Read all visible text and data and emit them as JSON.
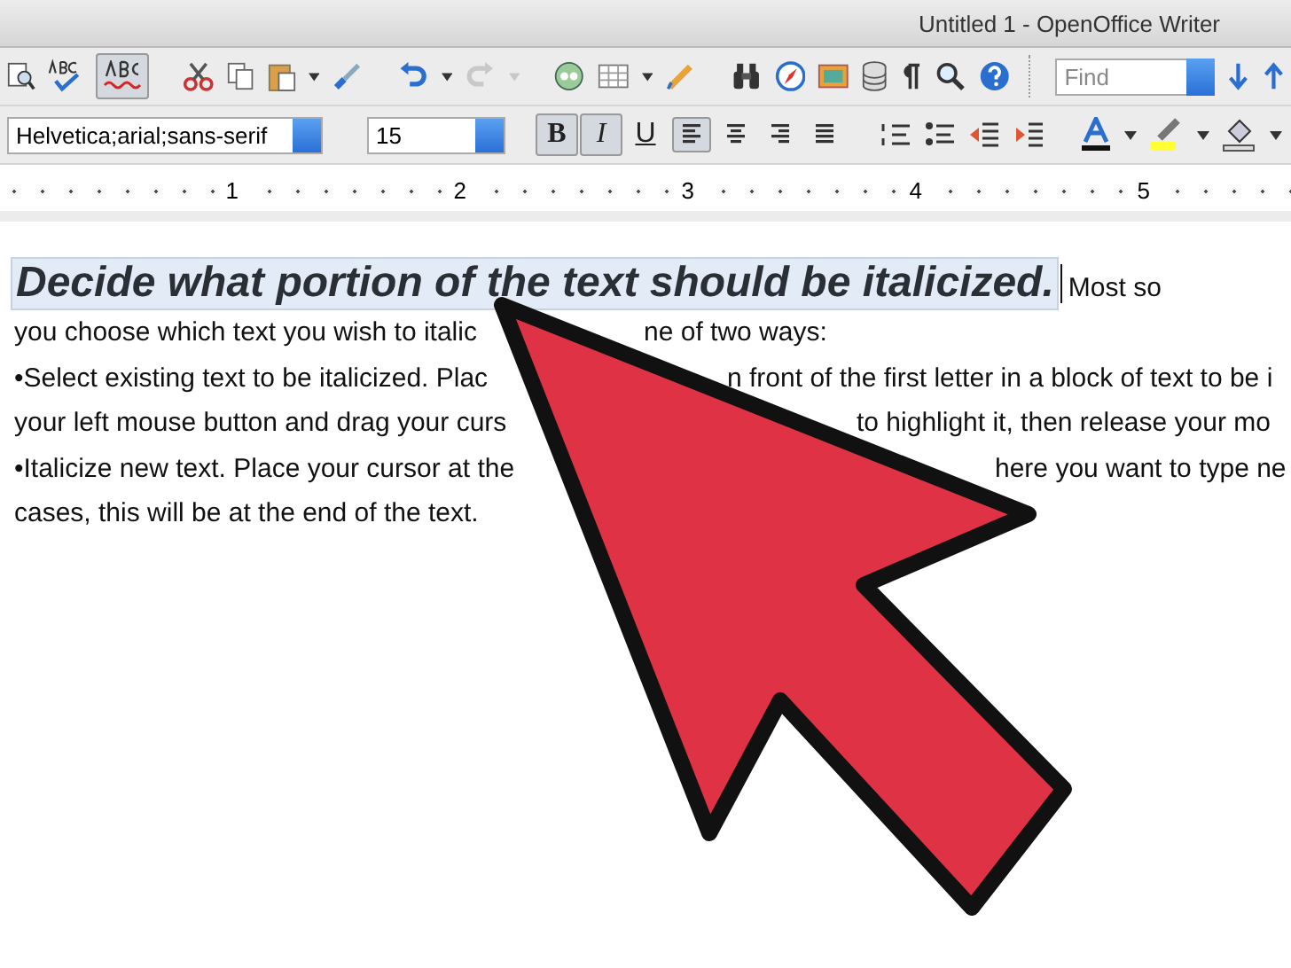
{
  "window": {
    "title": "Untitled 1 - OpenOffice Writer"
  },
  "standard_toolbar": {
    "autospell_selected": true,
    "redo_disabled": true,
    "find_field": {
      "placeholder": "Find"
    }
  },
  "formatting_toolbar": {
    "font_name": "Helvetica;arial;sans-serif",
    "font_size": "15",
    "bold": {
      "label": "B",
      "selected": true
    },
    "italic": {
      "label": "I",
      "selected": true
    },
    "underline": {
      "label": "U",
      "selected": false
    },
    "alignments": [
      {
        "selected": true
      },
      {
        "selected": false
      },
      {
        "selected": false
      },
      {
        "selected": false
      }
    ]
  },
  "ruler": {
    "numbers": [
      "1",
      "2",
      "3",
      "4",
      "5"
    ]
  },
  "document": {
    "heading": "Decide what portion of the text should be italicized.",
    "heading_tail": "Most so",
    "lines": [
      {
        "parts": [
          "you choose which text you wish to italic",
          "ne of two ways:"
        ]
      },
      {
        "parts": [
          "•Select existing text to be italicized. Plac",
          "n front of the first letter in a block of text to be i"
        ]
      },
      {
        "parts": [
          "your left mouse button and drag your curs",
          "to highlight it, then release your mo"
        ]
      },
      {
        "parts": [
          "•Italicize new text. Place your cursor at the",
          "here you want to type ne"
        ]
      },
      {
        "parts": [
          "cases, this will be at the end of the text."
        ]
      }
    ]
  }
}
